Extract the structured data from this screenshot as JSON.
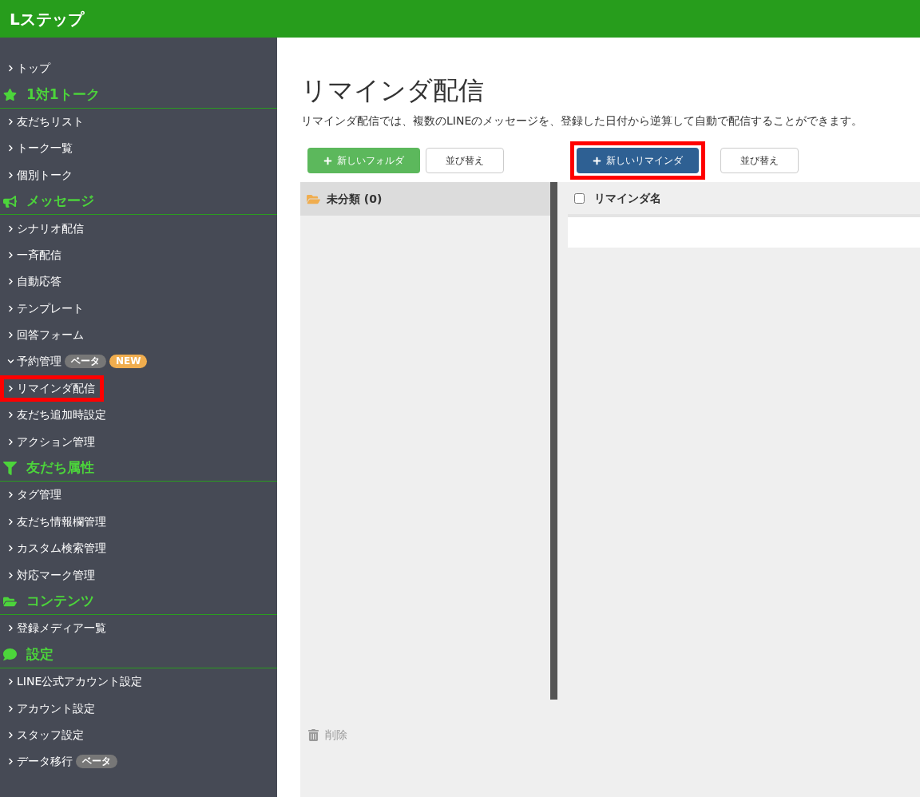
{
  "header": {
    "logo": "Lステップ"
  },
  "sidebar": {
    "items": [
      {
        "kind": "link",
        "label": "トップ",
        "expanded": false,
        "highlighted": false
      },
      {
        "kind": "section",
        "label": "1対1トーク"
      },
      {
        "kind": "link",
        "label": "友だちリスト",
        "expanded": false,
        "highlighted": false
      },
      {
        "kind": "link",
        "label": "トーク一覧",
        "expanded": false,
        "highlighted": false
      },
      {
        "kind": "link",
        "label": "個別トーク",
        "expanded": false,
        "highlighted": false
      },
      {
        "kind": "section",
        "label": "メッセージ"
      },
      {
        "kind": "link",
        "label": "シナリオ配信",
        "expanded": false,
        "highlighted": false
      },
      {
        "kind": "link",
        "label": "一斉配信",
        "expanded": false,
        "highlighted": false
      },
      {
        "kind": "link",
        "label": "自動応答",
        "expanded": false,
        "highlighted": false
      },
      {
        "kind": "link",
        "label": "テンプレート",
        "expanded": false,
        "highlighted": false
      },
      {
        "kind": "link",
        "label": "回答フォーム",
        "expanded": false,
        "highlighted": false
      },
      {
        "kind": "link",
        "label": "予約管理",
        "expanded": true,
        "highlighted": false,
        "badges": [
          {
            "kind": "beta",
            "label": "ベータ"
          },
          {
            "kind": "new",
            "label": "NEW"
          }
        ]
      },
      {
        "kind": "link",
        "label": "リマインダ配信",
        "expanded": false,
        "highlighted": true
      },
      {
        "kind": "link",
        "label": "友だち追加時設定",
        "expanded": false,
        "highlighted": false
      },
      {
        "kind": "link",
        "label": "アクション管理",
        "expanded": false,
        "highlighted": false
      },
      {
        "kind": "section",
        "label": "友だち属性"
      },
      {
        "kind": "link",
        "label": "タグ管理",
        "expanded": false,
        "highlighted": false
      },
      {
        "kind": "link",
        "label": "友だち情報欄管理",
        "expanded": false,
        "highlighted": false
      },
      {
        "kind": "link",
        "label": "カスタム検索管理",
        "expanded": false,
        "highlighted": false
      },
      {
        "kind": "link",
        "label": "対応マーク管理",
        "expanded": false,
        "highlighted": false
      },
      {
        "kind": "section",
        "label": "コンテンツ"
      },
      {
        "kind": "link",
        "label": "登録メディア一覧",
        "expanded": false,
        "highlighted": false
      },
      {
        "kind": "section",
        "label": "設定"
      },
      {
        "kind": "link",
        "label": "LINE公式アカウント設定",
        "expanded": false,
        "highlighted": false
      },
      {
        "kind": "link",
        "label": "アカウント設定",
        "expanded": false,
        "highlighted": false
      },
      {
        "kind": "link",
        "label": "スタッフ設定",
        "expanded": false,
        "highlighted": false
      },
      {
        "kind": "link",
        "label": "データ移行",
        "expanded": false,
        "highlighted": false,
        "badges": [
          {
            "kind": "beta",
            "label": "ベータ"
          }
        ]
      }
    ]
  },
  "page": {
    "title": "リマインダ配信",
    "description": "リマインダ配信では、複数のLINEのメッセージを、登録した日付から逆算して自動で配信することができます。"
  },
  "folder_toolbar": {
    "new_button": {
      "label": "新しいフォルダ",
      "highlighted": false
    },
    "sort_button": "並び替え"
  },
  "reminder_toolbar": {
    "new_button": {
      "label": "新しいリマインダ",
      "highlighted": true
    },
    "sort_button": "並び替え"
  },
  "folders": [
    {
      "label": "未分類 (0)",
      "selected": true
    }
  ],
  "table": {
    "select_all_checked": false,
    "columns": [
      "リマインダ名"
    ]
  },
  "delete_button": "削除"
}
